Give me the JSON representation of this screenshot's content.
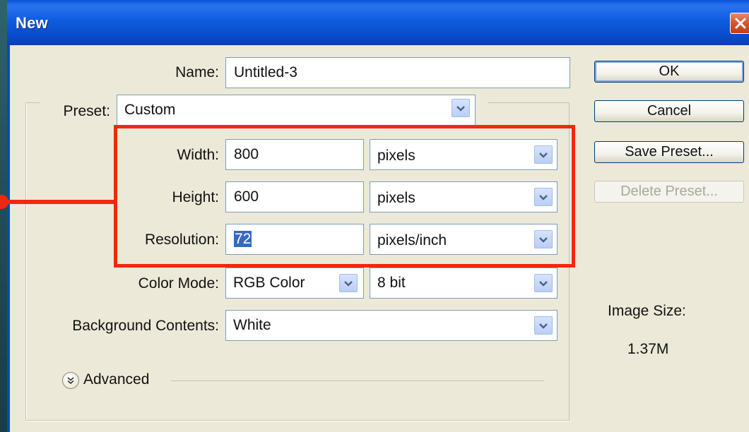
{
  "window": {
    "title": "New"
  },
  "form": {
    "name": {
      "label": "Name:",
      "value": "Untitled-3"
    },
    "preset": {
      "label": "Preset:",
      "value": "Custom"
    },
    "width": {
      "label": "Width:",
      "value": "800",
      "unit": "pixels"
    },
    "height": {
      "label": "Height:",
      "value": "600",
      "unit": "pixels"
    },
    "resolution": {
      "label": "Resolution:",
      "value": "72",
      "unit": "pixels/inch"
    },
    "color_mode": {
      "label": "Color Mode:",
      "value": "RGB Color",
      "depth": "8 bit"
    },
    "background": {
      "label": "Background Contents:",
      "value": "White"
    },
    "advanced": {
      "label": "Advanced"
    }
  },
  "buttons": {
    "ok": "OK",
    "cancel": "Cancel",
    "save_preset": "Save Preset...",
    "delete_preset": "Delete Preset..."
  },
  "image_size": {
    "label": "Image Size:",
    "value": "1.37M"
  },
  "colors": {
    "titlebar": "#0a54d8",
    "dialog_bg": "#ece9d8",
    "highlight_box": "#f0290c",
    "selection": "#316ac5",
    "close_button": "#d5532f"
  },
  "icons": [
    "close-icon",
    "chevron-down-icon",
    "advanced-expand-icon"
  ]
}
